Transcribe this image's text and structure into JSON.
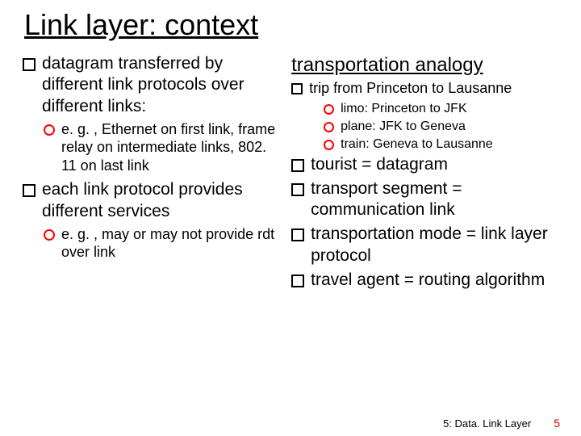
{
  "title": "Link layer: context",
  "left": {
    "item1": "datagram transferred by different link protocols over different links:",
    "item1_sub1": "e. g. , Ethernet on first link, frame relay on intermediate links, 802. 11 on last link",
    "item2": "each  link protocol provides different services",
    "item2_sub1": "e. g. , may or may not provide rdt over link"
  },
  "right": {
    "heading": "transportation analogy",
    "trip": "trip from Princeton to Lausanne",
    "trip_sub1": "limo: Princeton to JFK",
    "trip_sub2": "plane: JFK to Geneva",
    "trip_sub3": "train: Geneva to Lausanne",
    "eq1": "tourist = datagram",
    "eq2": "transport segment = communication link",
    "eq3": "transportation mode = link layer protocol",
    "eq4": "travel agent = routing algorithm"
  },
  "footer": {
    "label": "5: Data. Link Layer",
    "page": "5"
  }
}
